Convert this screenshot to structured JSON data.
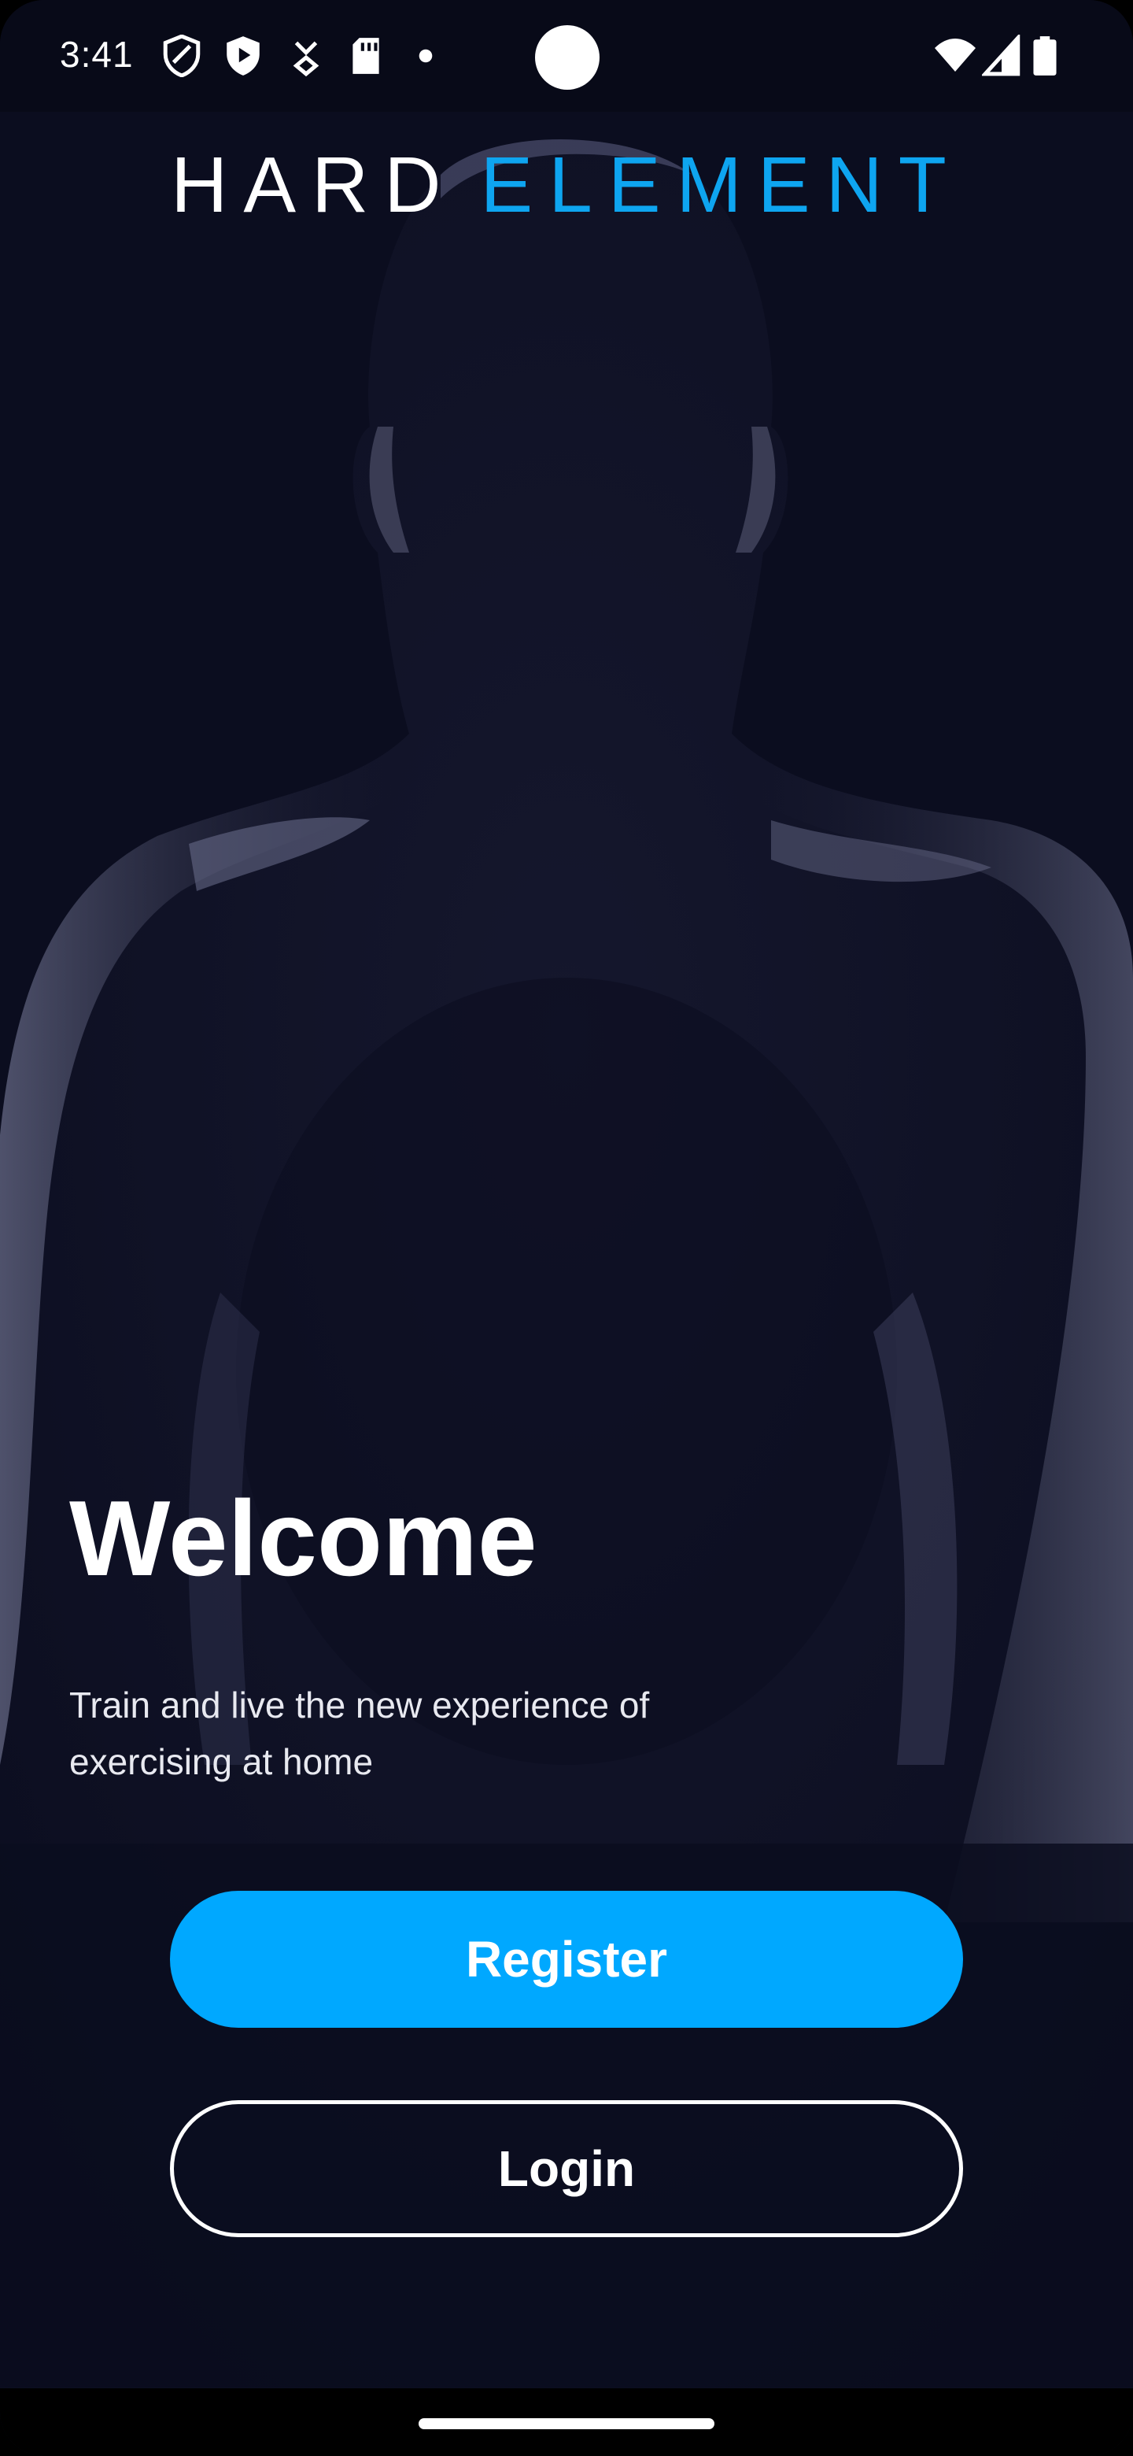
{
  "status_bar": {
    "time": "3:41",
    "left_icons": [
      "shield-icon",
      "play-protect-icon",
      "download-icon",
      "sd-card-icon",
      "notification-dot-icon"
    ],
    "right_icons": [
      "wifi-icon",
      "signal-icon",
      "battery-icon"
    ]
  },
  "brand": {
    "part1": "HARD",
    "part2": "ELEMENT",
    "accent_color": "#0ea5f0"
  },
  "welcome": {
    "title": "Welcome",
    "subtitle": "Train and live the new experience of exercising at home"
  },
  "actions": {
    "register_label": "Register",
    "login_label": "Login",
    "primary_color": "#00a8ff"
  },
  "colors": {
    "background": "#0b0d1f",
    "text": "#ffffff"
  }
}
